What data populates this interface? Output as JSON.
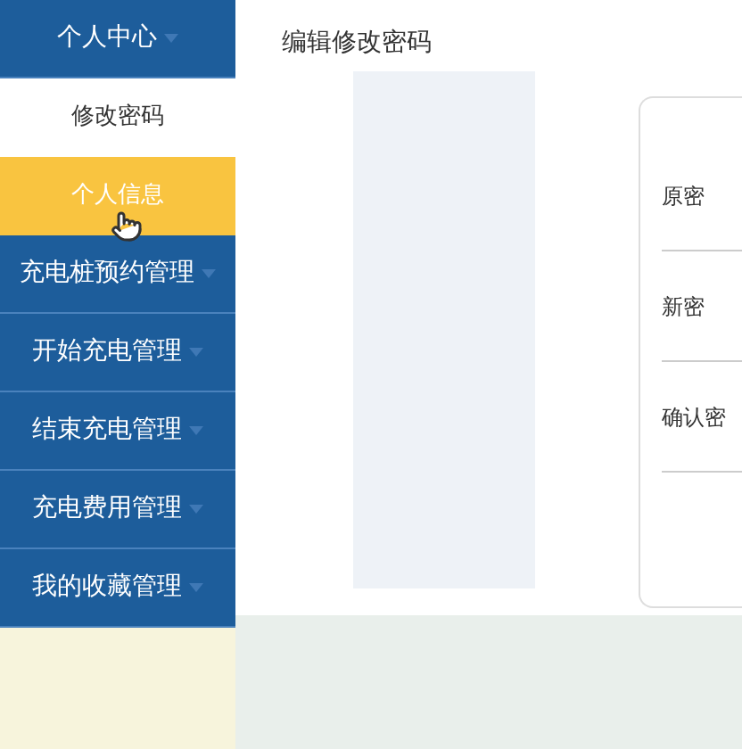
{
  "sidebar": {
    "items": [
      {
        "label": "个人中心",
        "kind": "group",
        "selected": false
      },
      {
        "label": "修改密码",
        "kind": "sub",
        "selected": false
      },
      {
        "label": "个人信息",
        "kind": "sub",
        "selected": true
      },
      {
        "label": "充电桩预约管理",
        "kind": "group",
        "selected": false
      },
      {
        "label": "开始充电管理",
        "kind": "group",
        "selected": false
      },
      {
        "label": "结束充电管理",
        "kind": "group",
        "selected": false
      },
      {
        "label": "充电费用管理",
        "kind": "group",
        "selected": false
      },
      {
        "label": "我的收藏管理",
        "kind": "group",
        "selected": false
      }
    ]
  },
  "page": {
    "title": "编辑修改密码"
  },
  "form": {
    "fields": [
      {
        "label": "原密"
      },
      {
        "label": "新密"
      },
      {
        "label": "确认密"
      }
    ]
  }
}
